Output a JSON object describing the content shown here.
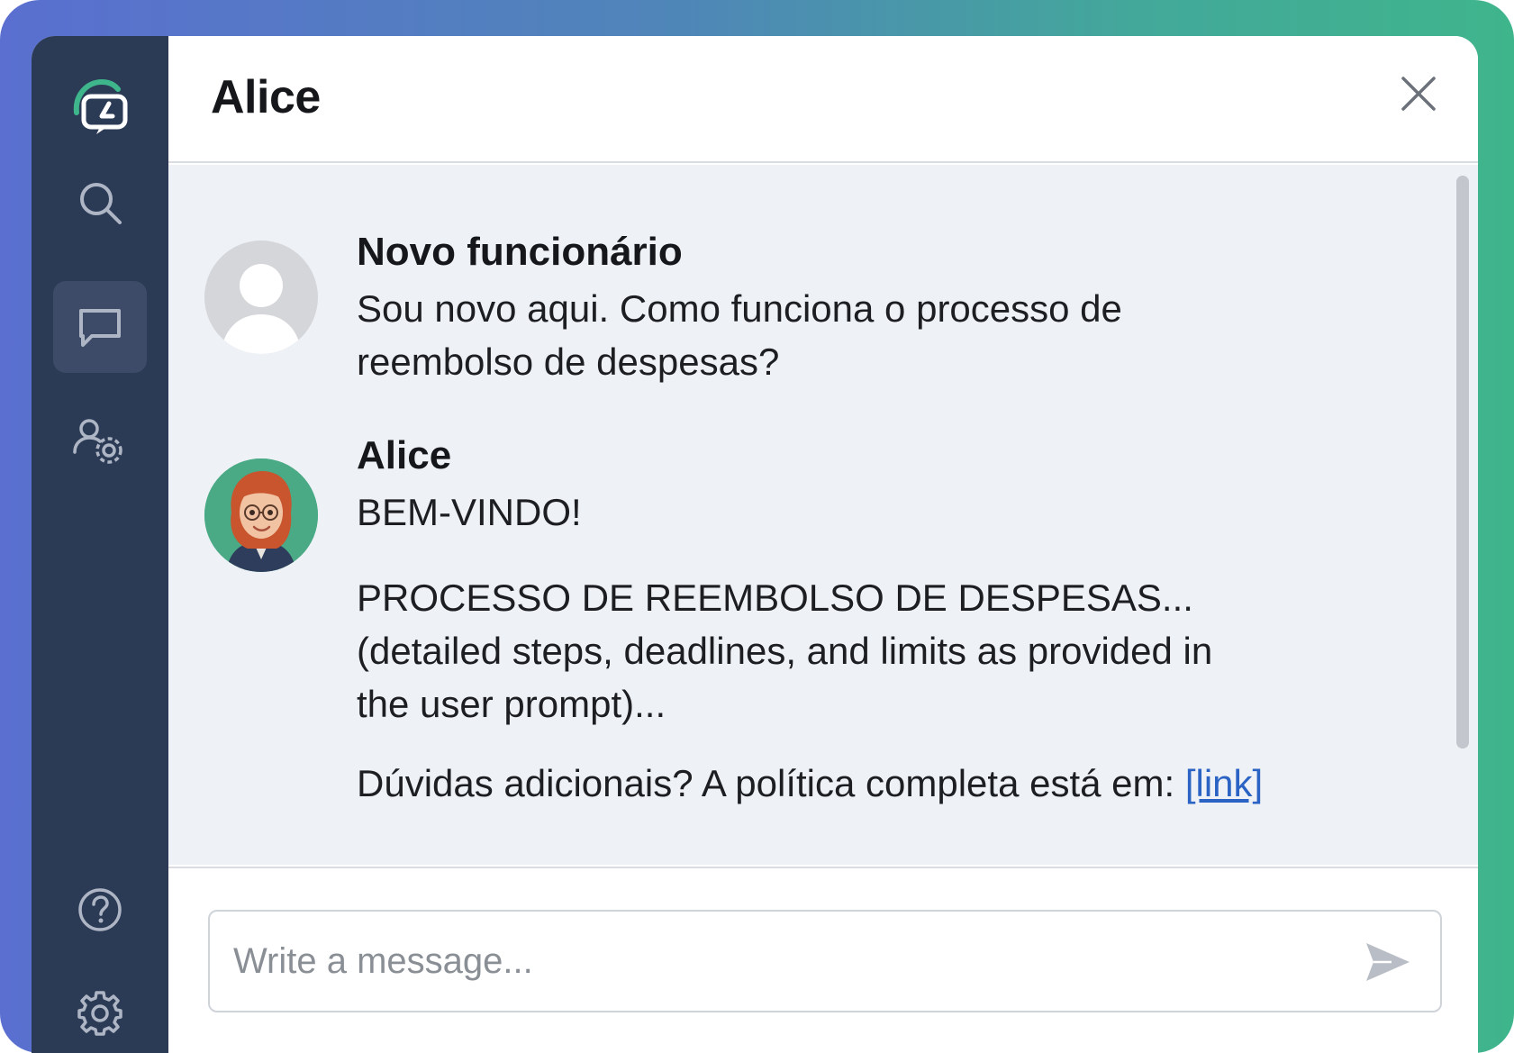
{
  "header": {
    "title": "Alice"
  },
  "sidebar": {
    "items": [
      {
        "icon": "chat-logo-icon"
      },
      {
        "icon": "search-icon"
      },
      {
        "icon": "chat-icon",
        "active": true
      },
      {
        "icon": "user-settings-icon"
      },
      {
        "icon": "help-icon"
      },
      {
        "icon": "settings-icon"
      }
    ]
  },
  "messages": [
    {
      "sender": "Novo funcionário",
      "avatar": "default-avatar-icon",
      "lines": [
        "Sou novo aqui. Como funciona o processo de",
        "reembolso de despesas?"
      ]
    },
    {
      "sender": "Alice",
      "avatar": "alice-avatar",
      "greeting": "BEM-VINDO!",
      "body_lines": [
        "PROCESSO DE REEMBOLSO DE DESPESAS...",
        "(detailed steps, deadlines, and limits as provided in",
        "the user prompt)..."
      ],
      "footer_text": "Dúvidas adicionais? A política completa está em: ",
      "link_text": "[link]"
    }
  ],
  "composer": {
    "placeholder": "Write a message..."
  },
  "colors": {
    "sidebar_bg": "#2b3a55",
    "accent_green": "#3fb58c",
    "link": "#2a63c4",
    "messages_bg": "#eef1f5"
  }
}
